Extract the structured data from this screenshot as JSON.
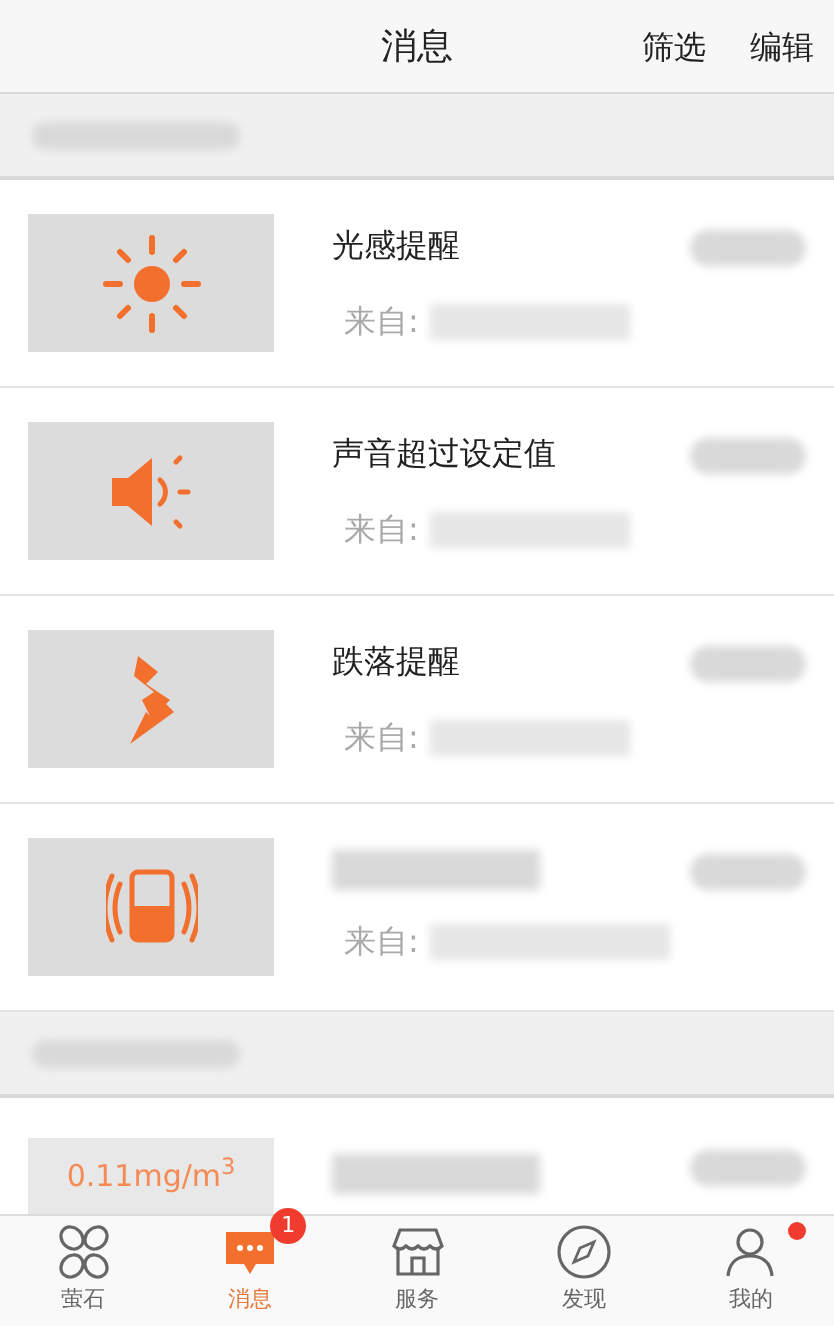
{
  "header": {
    "title": "消息",
    "actions": [
      "筛选",
      "编辑"
    ]
  },
  "sections": [
    {
      "items": [
        {
          "kind": "sun",
          "title": "光感提醒",
          "source_label": "来自:"
        },
        {
          "kind": "speaker",
          "title": "声音超过设定值",
          "source_label": "来自:"
        },
        {
          "kind": "bolt",
          "title": "跌落提醒",
          "source_label": "来自:"
        },
        {
          "kind": "device",
          "source_label": "来自:"
        }
      ]
    },
    {
      "items": [
        {
          "kind": "value",
          "value": "0.11mg/m$^{3}$"
        }
      ]
    }
  ],
  "tabs": [
    {
      "label": "萤石",
      "kind": "petals",
      "selected": false
    },
    {
      "label": "消息",
      "kind": "chat",
      "selected": true,
      "badge": "1"
    },
    {
      "label": "服务",
      "kind": "shop",
      "selected": false
    },
    {
      "label": "发现",
      "kind": "compass",
      "selected": false
    },
    {
      "label": "我的",
      "kind": "person",
      "selected": false,
      "dot": true
    }
  ]
}
